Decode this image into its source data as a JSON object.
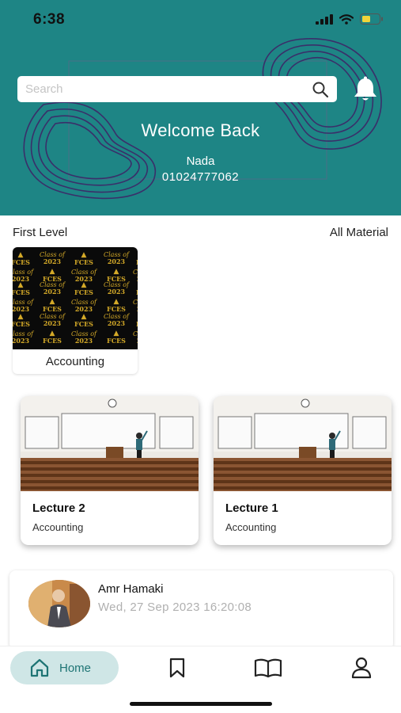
{
  "status_bar": {
    "time": "6:38"
  },
  "header": {
    "search_placeholder": "Search",
    "welcome": "Welcome Back",
    "user_name": "Nada",
    "user_phone": "01024777062"
  },
  "materials": {
    "level_label": "First Level",
    "all_label": "All Material",
    "subjects": [
      {
        "label": "Accounting"
      }
    ]
  },
  "lectures": [
    {
      "title": "Lecture 2",
      "subject": "Accounting"
    },
    {
      "title": "Lecture 1",
      "subject": "Accounting"
    }
  ],
  "post": {
    "author": "Amr Hamaki",
    "time": "Wed, 27 Sep 2023 16:20:08"
  },
  "nav": {
    "home_label": "Home",
    "items": [
      "home-icon",
      "bookmark-icon",
      "book-icon",
      "profile-icon"
    ]
  },
  "colors": {
    "primary": "#1e8585",
    "nav_active_bg": "#cfe6e6",
    "nav_active_text": "#1e7474"
  }
}
